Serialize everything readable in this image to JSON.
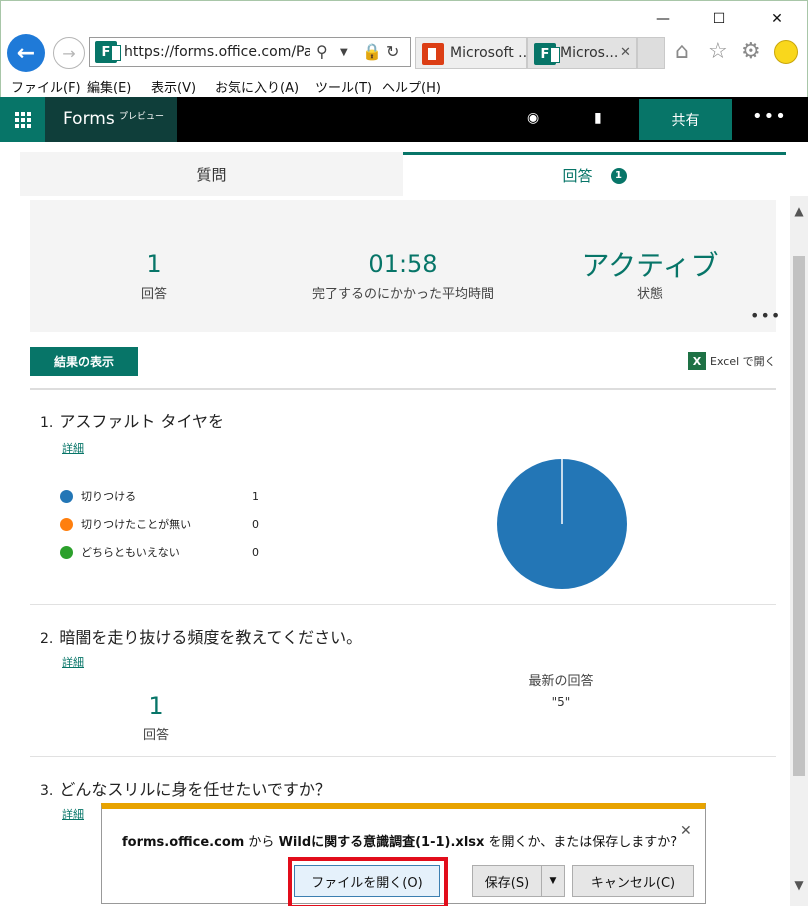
{
  "browser": {
    "url": "https://forms.office.com/Pa",
    "tabs": [
      {
        "label": "Microsoft ...",
        "icon": "office-icon"
      },
      {
        "label": "Micros...",
        "icon": "forms-icon",
        "close": "✕"
      }
    ],
    "window_controls": {
      "minimize": "—",
      "maximize": "☐",
      "close": "✕"
    },
    "menu": [
      "ファイル(F)",
      "編集(E)",
      "表示(V)",
      "お気に入り(A)",
      "ツール(T)",
      "ヘルプ(H)"
    ]
  },
  "forms_header": {
    "brand": "Forms",
    "brand_sub": "プレビュー",
    "share_label": "共有",
    "more_label": "•••"
  },
  "tabs": {
    "questions": "質問",
    "responses": "回答",
    "responses_count": "1"
  },
  "summary": {
    "responses_value": "1",
    "responses_label": "回答",
    "avg_time_value": "01:58",
    "avg_time_label": "完了するのにかかった平均時間",
    "status_value": "アクティブ",
    "status_label": "状態",
    "more": "•••"
  },
  "actions": {
    "view_results": "結果の表示",
    "open_excel": "Excel で開く"
  },
  "questions": [
    {
      "number": "1.",
      "title": "アスファルト タイヤを",
      "detail": "詳細",
      "options": [
        {
          "label": "切りつける",
          "count": "1",
          "color": "#2376b6"
        },
        {
          "label": "切りつけたことが無い",
          "count": "0",
          "color": "#ff7f0e"
        },
        {
          "label": "どちらともいえない",
          "count": "0",
          "color": "#2ca02c"
        }
      ]
    },
    {
      "number": "2.",
      "title": "暗闇を走り抜ける頻度を教えてください。",
      "detail": "詳細",
      "responses_value": "1",
      "responses_label": "回答",
      "latest_label": "最新の回答",
      "latest_value": "\"5\""
    },
    {
      "number": "3.",
      "title": "どんなスリルに身を任せたいですか？",
      "detail": "詳細"
    }
  ],
  "chart_data": {
    "type": "pie",
    "categories": [
      "切りつける",
      "切りつけたことが無い",
      "どちらともいえない"
    ],
    "values": [
      1,
      0,
      0
    ],
    "colors": [
      "#2376b6",
      "#ff7f0e",
      "#2ca02c"
    ]
  },
  "download_bar": {
    "msg_pre": "forms.office.com",
    "msg_mid1": " から ",
    "msg_file": "Wildに関する意識調査(1-1).xlsx",
    "msg_post": " を開くか、または保存しますか?",
    "open_label": "ファイルを開く(O)",
    "save_label": "保存(S)",
    "save_arrow": "▼",
    "cancel_label": "キャンセル(C)",
    "close": "✕"
  }
}
